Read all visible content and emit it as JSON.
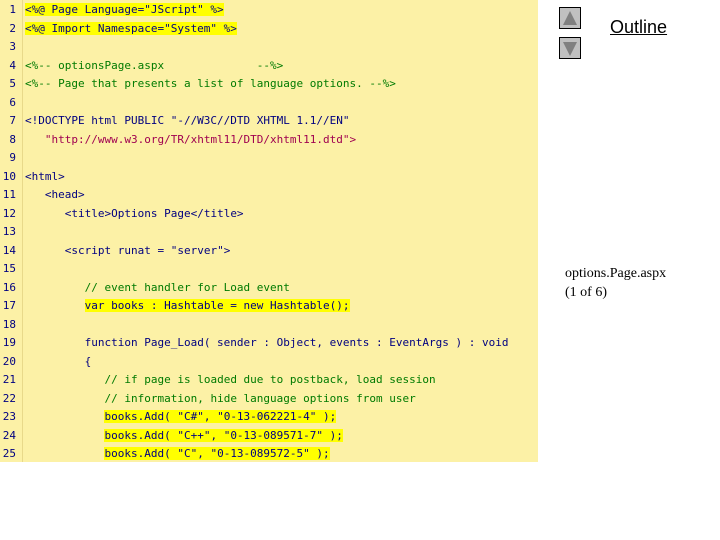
{
  "outline": {
    "title": "Outline"
  },
  "caption": {
    "file": "options.Page.aspx",
    "page": "(1 of 6)"
  },
  "colors": {
    "code_bg": "#fcf1a6",
    "highlight": "#ffff00",
    "keyword": "#000080",
    "string": "#a00050",
    "comment": "#007a00"
  },
  "code": {
    "lines": [
      {
        "n": "1",
        "text": "<%@ Page Language=\"JScript\" %>"
      },
      {
        "n": "2",
        "text": "<%@ Import Namespace=\"System\" %>"
      },
      {
        "n": "3",
        "text": ""
      },
      {
        "n": "4",
        "text": "<%-- optionsPage.aspx              --%>"
      },
      {
        "n": "5",
        "text": "<%-- Page that presents a list of language options. --%>"
      },
      {
        "n": "6",
        "text": ""
      },
      {
        "n": "7",
        "text": "<!DOCTYPE html PUBLIC \"-//W3C//DTD XHTML 1.1//EN\""
      },
      {
        "n": "8",
        "text": "   \"http://www.w3.org/TR/xhtml11/DTD/xhtml11.dtd\">"
      },
      {
        "n": "9",
        "text": ""
      },
      {
        "n": "10",
        "text": "<html>"
      },
      {
        "n": "11",
        "text": "   <head>"
      },
      {
        "n": "12",
        "text": "      <title>Options Page</title>"
      },
      {
        "n": "13",
        "text": ""
      },
      {
        "n": "14",
        "text": "      <script runat = \"server\">"
      },
      {
        "n": "15",
        "text": ""
      },
      {
        "n": "16",
        "text": "         // event handler for Load event"
      },
      {
        "n": "17",
        "text": "         var books : Hashtable = new Hashtable();"
      },
      {
        "n": "18",
        "text": ""
      },
      {
        "n": "19",
        "text": "         function Page_Load( sender : Object, events : EventArgs ) : void"
      },
      {
        "n": "20",
        "text": "         {"
      },
      {
        "n": "21",
        "text": "            // if page is loaded due to postback, load session"
      },
      {
        "n": "22",
        "text": "            // information, hide language options from user"
      },
      {
        "n": "23",
        "text": "            books.Add( \"C#\", \"0-13-062221-4\" );"
      },
      {
        "n": "24",
        "text": "            books.Add( \"C++\", \"0-13-089571-7\" );"
      },
      {
        "n": "25",
        "text": "            books.Add( \"C\", \"0-13-089572-5\" );"
      }
    ]
  }
}
